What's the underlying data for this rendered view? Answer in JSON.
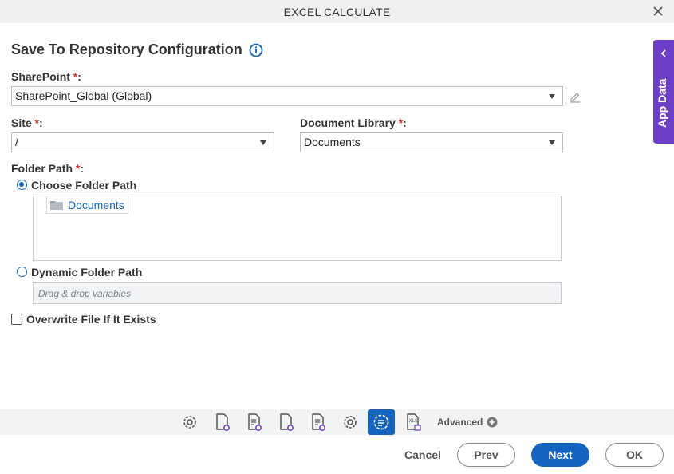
{
  "window": {
    "title": "EXCEL CALCULATE"
  },
  "heading": "Save To Repository Configuration",
  "sharepoint": {
    "label": "SharePoint",
    "req": "*",
    "colon": ":",
    "value": "SharePoint_Global (Global)"
  },
  "site": {
    "label": "Site",
    "req": "*",
    "colon": ":",
    "value": "/"
  },
  "library": {
    "label": "Document Library",
    "req": "*",
    "colon": ":",
    "value": "Documents"
  },
  "folder": {
    "label": "Folder Path",
    "req": "*",
    "colon": ":",
    "choose_label": "Choose Folder Path",
    "selected_folder": "Documents",
    "dynamic_label": "Dynamic Folder Path",
    "dynamic_placeholder": "Drag & drop variables",
    "selected_option": "choose"
  },
  "overwrite": {
    "label": "Overwrite File If It Exists",
    "checked": false
  },
  "app_data": {
    "label": "App Data"
  },
  "toolbar": {
    "icons": [
      "gear-icon",
      "document-gear-icon",
      "document-list-gear-icon",
      "document-gear-icon",
      "document-list-gear-icon",
      "gear-icon",
      "repository-gear-icon",
      "xls-icon"
    ],
    "active_index": 6,
    "advanced_label": "Advanced"
  },
  "buttons": {
    "cancel": "Cancel",
    "prev": "Prev",
    "next": "Next",
    "ok": "OK"
  },
  "colors": {
    "accent": "#1565c0",
    "app_data": "#6d3fc9",
    "required": "#d0342c"
  }
}
